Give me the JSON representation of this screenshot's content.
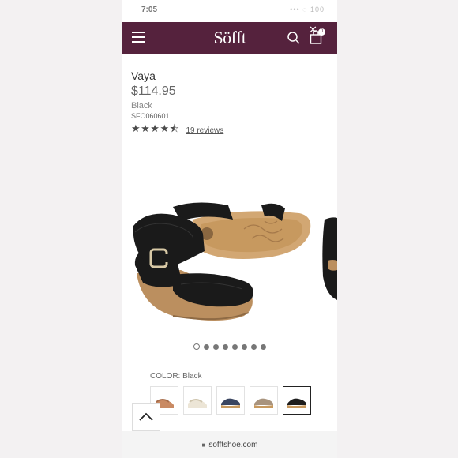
{
  "status_bar": {
    "time": "7:05",
    "icons": "••• ◌ 100"
  },
  "header": {
    "logo": "Söfft",
    "cart_count": "0",
    "close_glyph": "✕"
  },
  "product": {
    "name": "Vaya",
    "price": "$114.95",
    "color": "Black",
    "sku": "SFO060601",
    "rating": 4.5,
    "stars_display": "★★★★⯪",
    "reviews_label": "19 reviews"
  },
  "gallery": {
    "image_count": 8,
    "active_index": 0
  },
  "color_selector": {
    "label": "COLOR: Black",
    "swatches": [
      {
        "name": "tan",
        "color": "#c98a63"
      },
      {
        "name": "white",
        "color": "#ece5d6"
      },
      {
        "name": "navy",
        "color": "#3a4560"
      },
      {
        "name": "taupe",
        "color": "#a8937d"
      },
      {
        "name": "black",
        "color": "#1d1d1d"
      }
    ],
    "selected_index": 4
  },
  "browser": {
    "url": "sofftshoe.com"
  },
  "colors": {
    "header_bg": "#55223d",
    "sandal": "#1a1a1a",
    "sole": "#d2a773",
    "cork": "#bb8f5f"
  }
}
